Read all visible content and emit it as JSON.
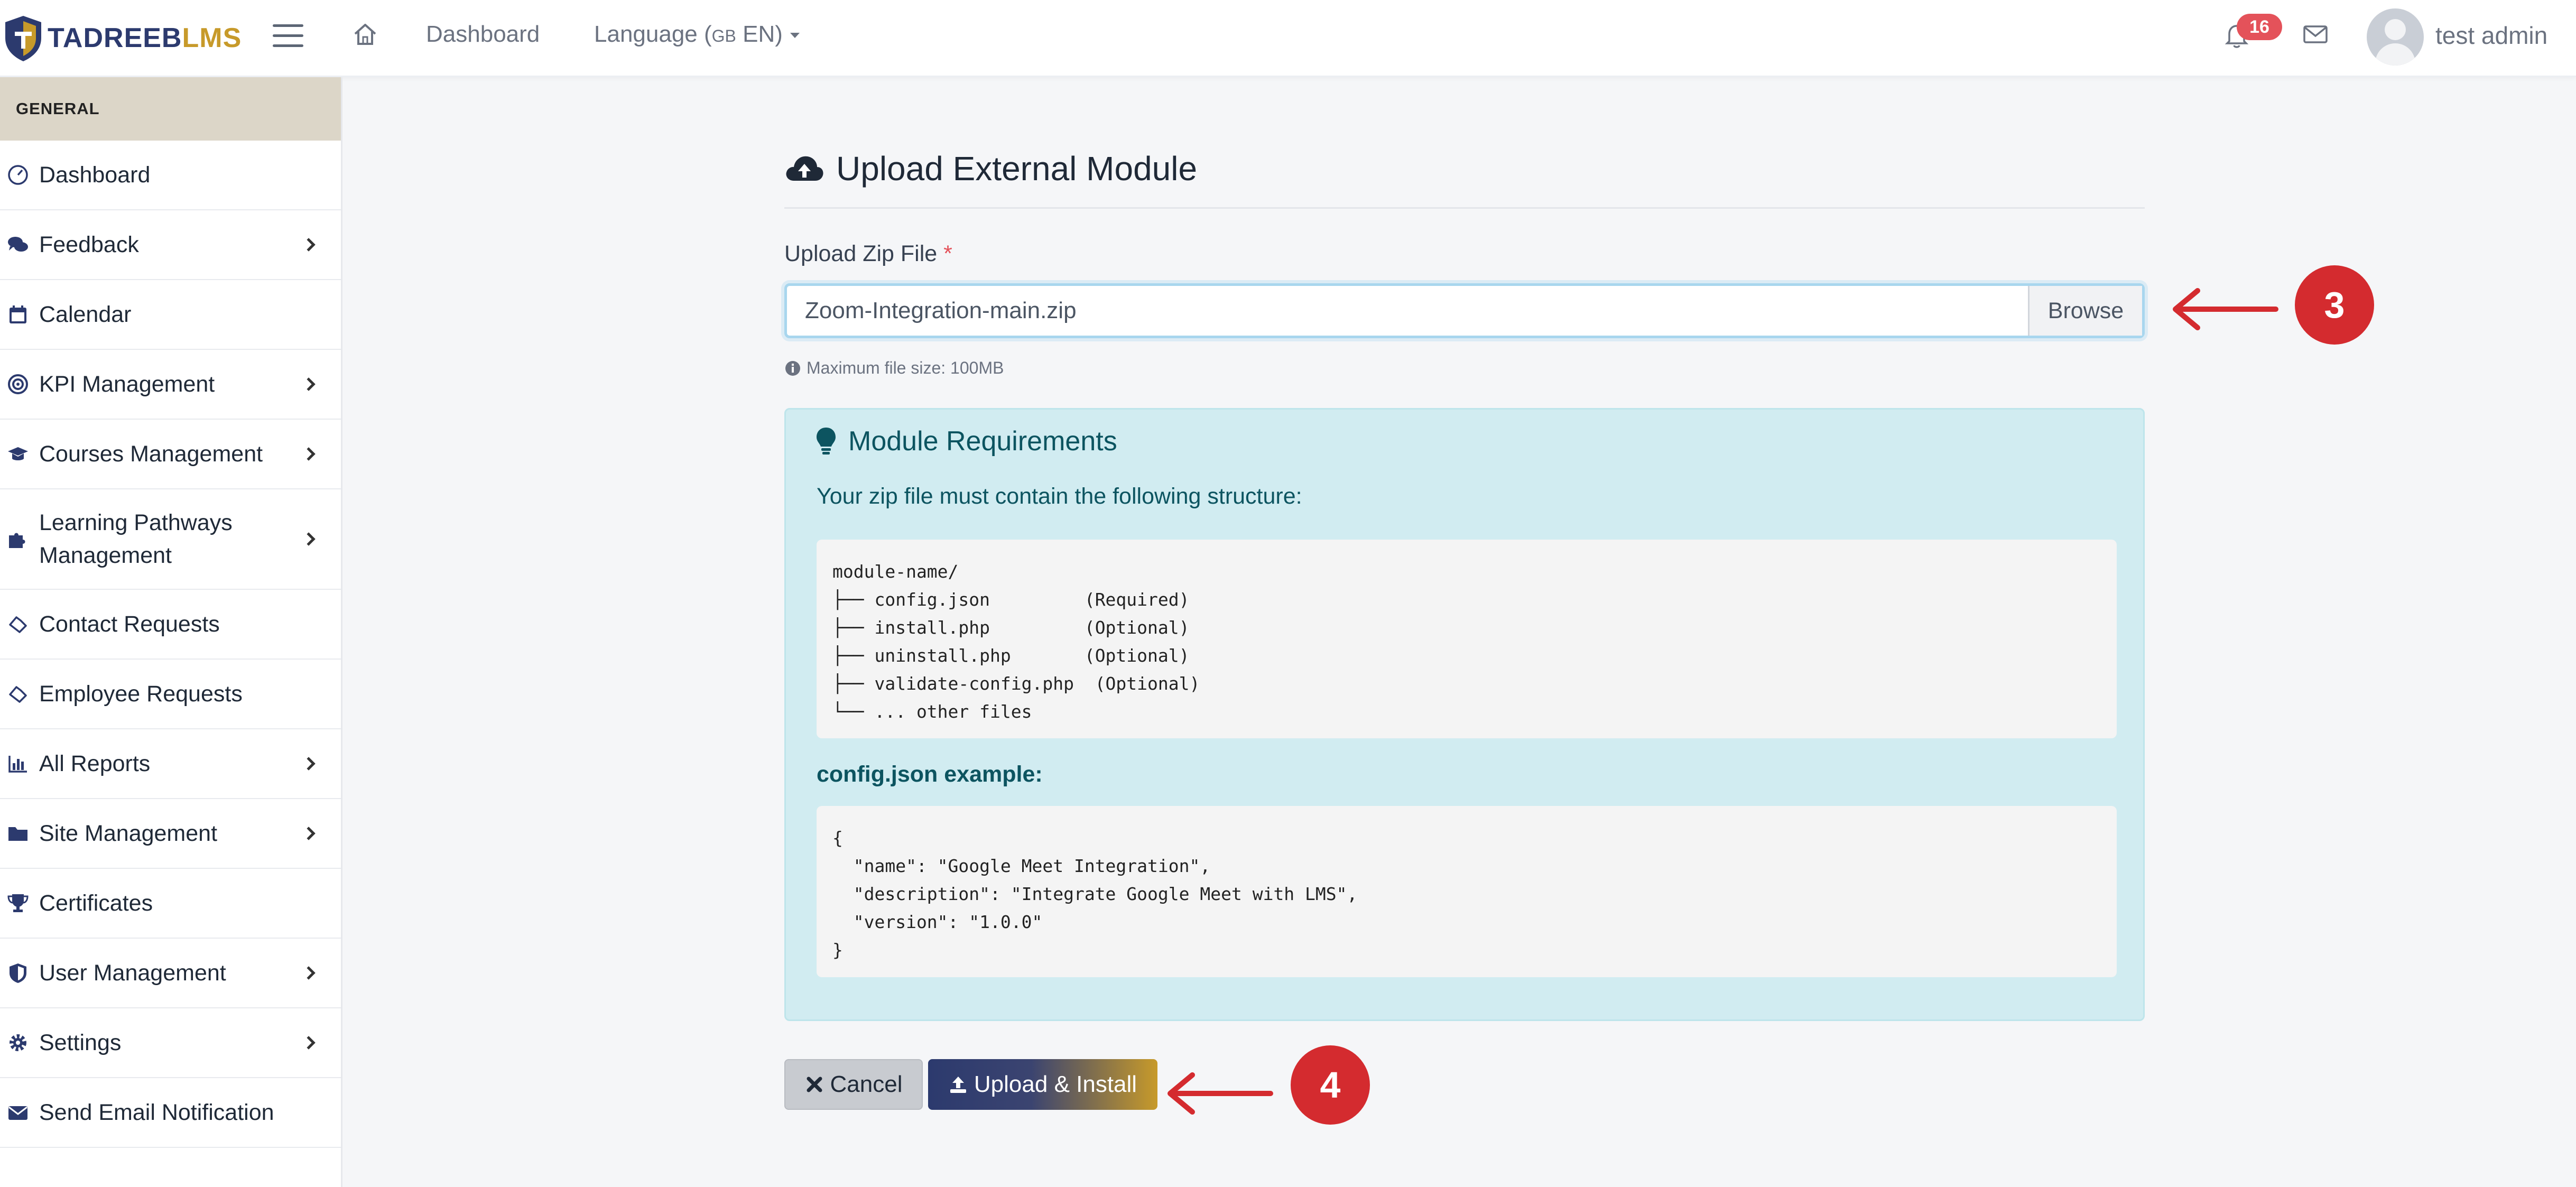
{
  "header": {
    "logo_text_a": "TADREEB",
    "logo_text_b": "LMS",
    "nav_dashboard": "Dashboard",
    "language_label": "Language (",
    "language_flag": "GB",
    "language_code": " EN)",
    "notification_count": "16",
    "user_name": "test admin"
  },
  "sidebar": {
    "section": "GENERAL",
    "items": [
      {
        "label": "Dashboard",
        "icon": "gauge-icon",
        "has_children": false
      },
      {
        "label": "Feedback",
        "icon": "comments-icon",
        "has_children": true
      },
      {
        "label": "Calendar",
        "icon": "calendar-icon",
        "has_children": false
      },
      {
        "label": "KPI Management",
        "icon": "target-icon",
        "has_children": true
      },
      {
        "label": "Courses Management",
        "icon": "graduation-cap-icon",
        "has_children": true
      },
      {
        "label": "Learning Pathways Management",
        "icon": "puzzle-icon",
        "has_children": true
      },
      {
        "label": "Contact Requests",
        "icon": "handshake-icon",
        "has_children": false
      },
      {
        "label": "Employee Requests",
        "icon": "handshake-icon",
        "has_children": false
      },
      {
        "label": "All Reports",
        "icon": "bar-chart-icon",
        "has_children": true
      },
      {
        "label": "Site Management",
        "icon": "folder-icon",
        "has_children": true
      },
      {
        "label": "Certificates",
        "icon": "trophy-icon",
        "has_children": false
      },
      {
        "label": "User Management",
        "icon": "shield-icon",
        "has_children": true
      },
      {
        "label": "Settings",
        "icon": "gear-icon",
        "has_children": true
      },
      {
        "label": "Send Email Notification",
        "icon": "envelope-icon",
        "has_children": false
      }
    ]
  },
  "main": {
    "title": "Upload External Module",
    "field_label": "Upload Zip File",
    "required_mark": "*",
    "file_name": "Zoom-Integration-main.zip",
    "browse_label": "Browse",
    "hint": "Maximum file size: 100MB",
    "requirements": {
      "title": "Module Requirements",
      "subtitle": "Your zip file must contain the following structure:",
      "structure": "module-name/\n├── config.json         (Required)\n├── install.php         (Optional)\n├── uninstall.php       (Optional)\n├── validate-config.php  (Optional)\n└── ... other files",
      "config_label": "config.json example:",
      "config_example": "{\n  \"name\": \"Google Meet Integration\",\n  \"description\": \"Integrate Google Meet with LMS\",\n  \"version\": \"1.0.0\"\n}"
    },
    "cancel_label": "Cancel",
    "upload_label": "Upload & Install"
  },
  "annotations": {
    "step3": "3",
    "step4": "4"
  },
  "colors": {
    "brand_navy": "#2c3a6e",
    "brand_gold": "#c79a2a",
    "info_bg": "#d1ecf1",
    "info_text": "#0c5460",
    "marker_red": "#d42b2f"
  }
}
